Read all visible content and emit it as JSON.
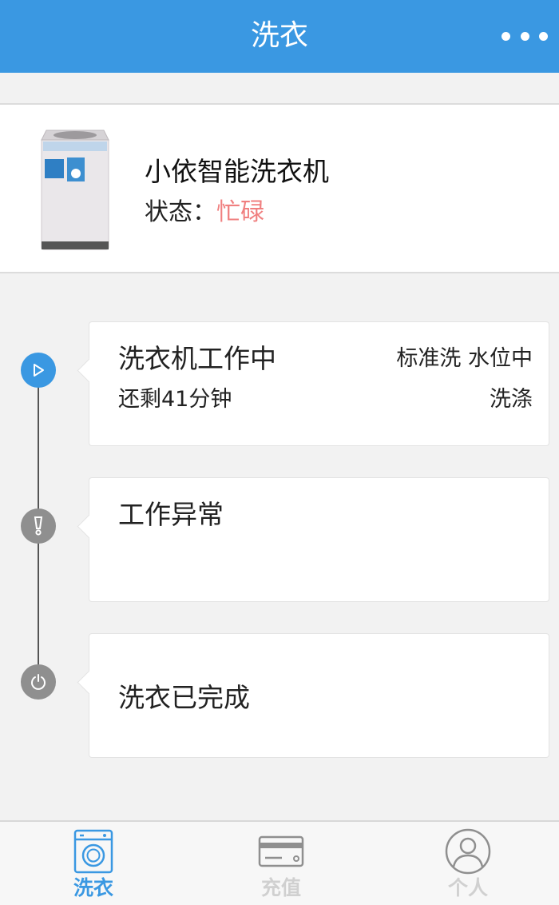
{
  "header": {
    "title": "洗衣"
  },
  "device": {
    "name": "小依智能洗衣机",
    "status_label": "状态：",
    "status_value": "忙碌",
    "status_color": "#f07f7f"
  },
  "timeline": [
    {
      "icon": "play-icon",
      "title": "洗衣机工作中",
      "subtitle": "还剩41分钟",
      "mode": "标准洗 水位中",
      "stage": "洗涤",
      "state": "active"
    },
    {
      "icon": "warning-icon",
      "title": "工作异常",
      "state": "idle"
    },
    {
      "icon": "power-icon",
      "title": "洗衣已完成",
      "state": "idle"
    }
  ],
  "tabs": [
    {
      "label": "洗衣",
      "icon": "washing-machine-icon",
      "active": true
    },
    {
      "label": "充值",
      "icon": "card-icon",
      "active": false
    },
    {
      "label": "个人",
      "icon": "user-icon",
      "active": false
    }
  ],
  "colors": {
    "primary": "#3a98e2",
    "inactive_tab": "#d0d0d0",
    "node_idle": "#8f8f8f"
  }
}
